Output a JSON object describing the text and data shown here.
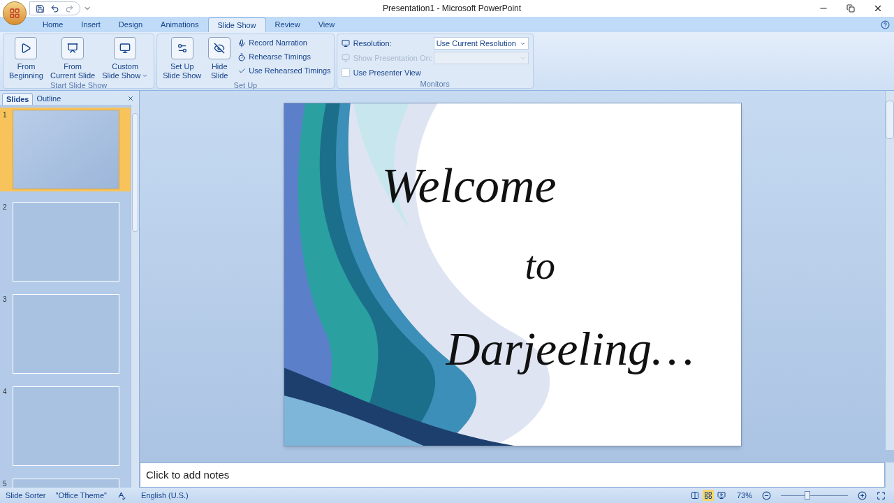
{
  "window": {
    "title": "Presentation1 - Microsoft PowerPoint"
  },
  "tabs": [
    {
      "label": "Home",
      "selected": false
    },
    {
      "label": "Insert",
      "selected": false
    },
    {
      "label": "Design",
      "selected": false
    },
    {
      "label": "Animations",
      "selected": false
    },
    {
      "label": "Slide Show",
      "selected": true
    },
    {
      "label": "Review",
      "selected": false
    },
    {
      "label": "View",
      "selected": false
    }
  ],
  "ribbon": {
    "start_group": {
      "label": "Start Slide Show",
      "buttons": [
        {
          "lines": [
            "From",
            "Beginning"
          ],
          "dropdown": false
        },
        {
          "lines": [
            "From",
            "Current Slide"
          ],
          "dropdown": false
        },
        {
          "lines": [
            "Custom",
            "Slide Show"
          ],
          "dropdown": true
        }
      ]
    },
    "setup_group": {
      "label": "Set Up",
      "buttons": [
        {
          "lines": [
            "Set Up",
            "Slide Show"
          ]
        },
        {
          "lines": [
            "Hide",
            "Slide"
          ]
        }
      ],
      "items": [
        {
          "kind": "command",
          "label": "Record Narration"
        },
        {
          "kind": "command",
          "label": "Rehearse Timings"
        },
        {
          "kind": "checkbox",
          "label": "Use Rehearsed Timings",
          "checked": true
        }
      ]
    },
    "monitors_group": {
      "label": "Monitors",
      "resolution_label": "Resolution:",
      "resolution_value": "Use Current Resolution",
      "show_on_label": "Show Presentation On:",
      "show_on_disabled": true,
      "presenter_view_label": "Use Presenter View",
      "presenter_view_checked": false
    }
  },
  "slides_pane": {
    "tabs": [
      {
        "label": "Slides",
        "selected": true
      },
      {
        "label": "Outline",
        "selected": false
      }
    ],
    "slides": [
      {
        "number": "1",
        "selected": true
      },
      {
        "number": "2",
        "selected": false
      },
      {
        "number": "3",
        "selected": false
      },
      {
        "number": "4",
        "selected": false
      },
      {
        "number": "5",
        "selected": false
      }
    ]
  },
  "slide": {
    "lines": [
      "Welcome",
      "to",
      "Darjeeling…"
    ]
  },
  "notes": {
    "placeholder": "Click to add notes"
  },
  "status_bar": {
    "view": "Slide Sorter",
    "theme": "\"Office Theme\"",
    "language": "English (U.S.)",
    "views": [
      {
        "kind": "normal",
        "selected": false
      },
      {
        "kind": "sorter",
        "selected": true
      },
      {
        "kind": "show",
        "selected": false
      }
    ],
    "zoom": "73%",
    "zoom_slider": {
      "level": 0.4
    }
  }
}
